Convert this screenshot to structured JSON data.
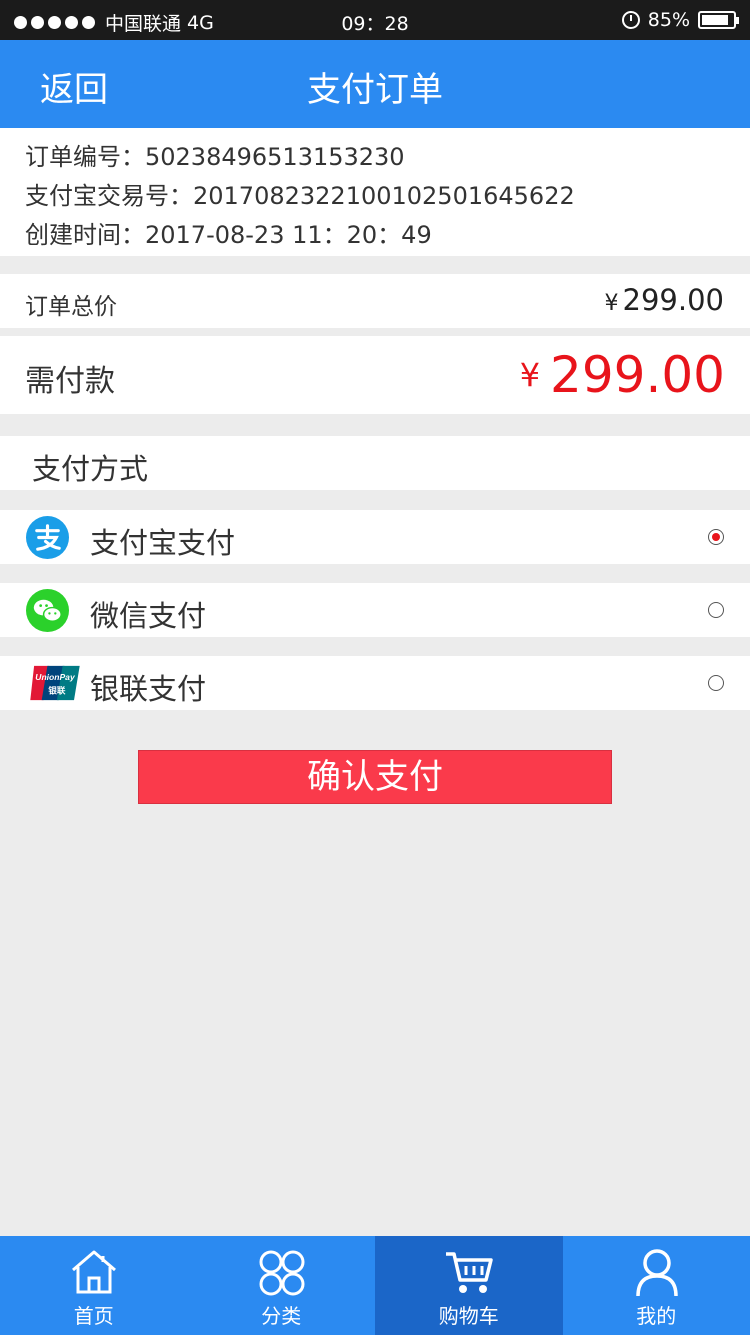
{
  "status_bar": {
    "carrier": "中国联通",
    "network": "4G",
    "time": "09：28",
    "battery": "85%"
  },
  "nav": {
    "back_label": "返回",
    "title": "支付订单"
  },
  "order": {
    "number": "订单编号：50238496513153230",
    "alipay_trade": "支付宝交易号：2017082322100102501645622",
    "created": "创建时间：2017-08-23  11：20：49"
  },
  "total": {
    "label": "订单总价",
    "currency": "¥",
    "amount": "299.00"
  },
  "payable": {
    "label": "需付款",
    "currency": "¥",
    "amount": "299.00"
  },
  "methods": {
    "header": "支付方式",
    "items": [
      {
        "label": "支付宝支付",
        "icon": "alipay-icon",
        "selected": true
      },
      {
        "label": "微信支付",
        "icon": "wechat-icon",
        "selected": false
      },
      {
        "label": "银联支付",
        "icon": "unionpay-icon",
        "selected": false
      }
    ],
    "unionpay_logo_text": "UnionPay 银联"
  },
  "confirm_label": "确认支付",
  "tabs": [
    {
      "label": "首页",
      "icon": "home-icon",
      "active": false
    },
    {
      "label": "分类",
      "icon": "category-icon",
      "active": false
    },
    {
      "label": "购物车",
      "icon": "cart-icon",
      "active": true
    },
    {
      "label": "我的",
      "icon": "user-icon",
      "active": false
    }
  ],
  "colors": {
    "primary": "#2b8af1",
    "active_tab": "#1b66c8",
    "price_red": "#e8141b",
    "button": "#fa3a4b",
    "background": "#ececec"
  }
}
